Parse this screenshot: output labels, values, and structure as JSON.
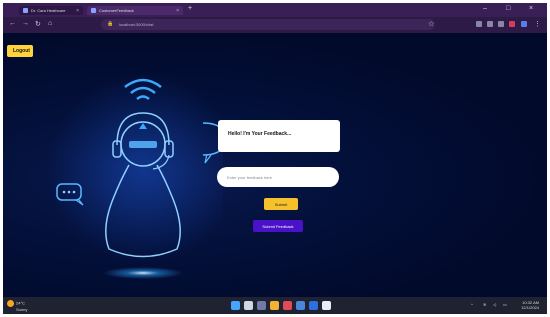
{
  "browser": {
    "tabs": [
      {
        "label": "Dr. Cara Heathcare"
      },
      {
        "label": "CustomerFeedback"
      }
    ],
    "address": "localhost:3000/chat"
  },
  "page": {
    "logout_label": "Logout",
    "chat_prompt": "Hello! I'm Your Feedback...",
    "input_placeholder": "Enter your feedback here",
    "submit_label": "Submit",
    "feedback_button_label": "Submit Feedback"
  },
  "taskbar": {
    "weather": "24°C",
    "weather_desc": "Sunny",
    "time": "10:32 AM",
    "date": "12/1/2024"
  },
  "colors": {
    "tab_bar": "#3a1f56",
    "page_bg": "#020a2c",
    "glow": "#2aa3ff",
    "logout": "#ffd43b",
    "submit": "#f6c12b",
    "feedback_button": "#4912c8"
  }
}
